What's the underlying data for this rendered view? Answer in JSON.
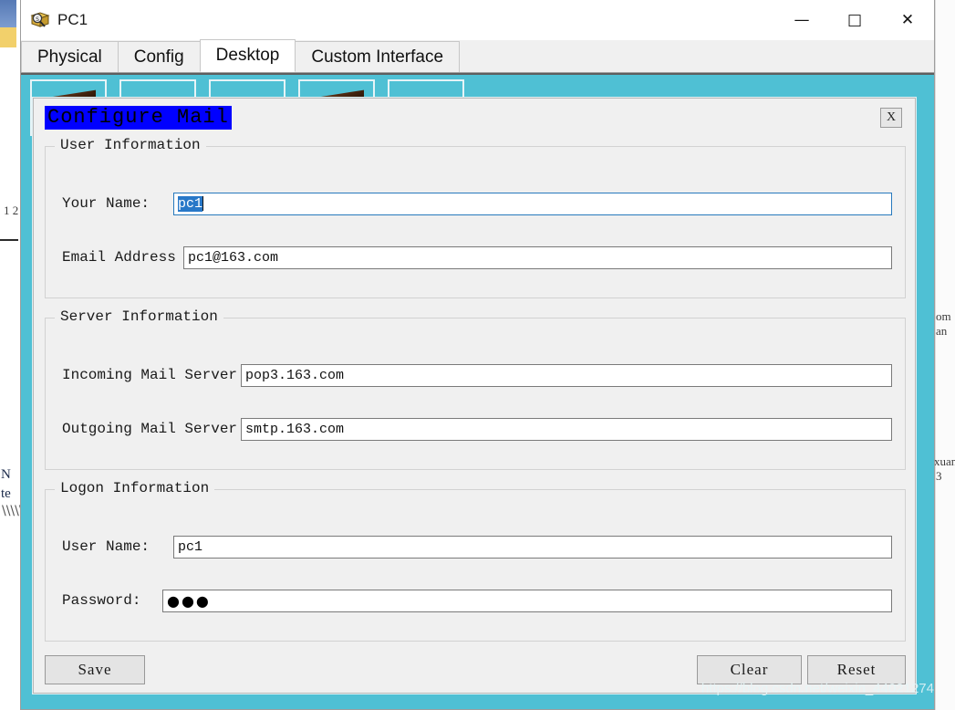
{
  "window": {
    "title": "PC1",
    "icon": "magnifier-package-icon",
    "controls": {
      "minimize_label": "—",
      "maximize_label": "□",
      "close_label": "✕"
    }
  },
  "tabs": [
    {
      "label": "Physical",
      "active": false
    },
    {
      "label": "Config",
      "active": false
    },
    {
      "label": "Desktop",
      "active": true
    },
    {
      "label": "Custom Interface",
      "active": false
    }
  ],
  "dialog": {
    "title": "Configure Mail",
    "close_label": "X",
    "groups": [
      {
        "legend": "User Information",
        "fields": [
          {
            "label": "Your Name:",
            "value": "pc1",
            "focused": true,
            "selected": true,
            "masked": false
          },
          {
            "label": "Email Address",
            "value": "pc1@163.com",
            "focused": false,
            "selected": false,
            "masked": false
          }
        ]
      },
      {
        "legend": "Server Information",
        "fields": [
          {
            "label": "Incoming Mail Server",
            "value": "pop3.163.com",
            "focused": false,
            "selected": false,
            "masked": false
          },
          {
            "label": "Outgoing Mail Server",
            "value": "smtp.163.com",
            "focused": false,
            "selected": false,
            "masked": false
          }
        ]
      },
      {
        "legend": "Logon Information",
        "fields": [
          {
            "label": "User Name:",
            "value": "pc1",
            "focused": false,
            "selected": false,
            "masked": false
          },
          {
            "label": "Password:",
            "value": "●●●",
            "focused": false,
            "selected": false,
            "masked": true
          }
        ]
      }
    ],
    "buttons": {
      "save": "Save",
      "clear": "Clear",
      "reset": "Reset"
    }
  },
  "background": {
    "watermark": "https://blog.csdn.net/weixin_44021274",
    "fragments": {
      "left_top": "1\n2",
      "left_mid_a": "N",
      "left_mid_b": "te",
      "right_a": "om",
      "right_b": "an",
      "right_c": "xuan",
      "right_d": "3"
    }
  },
  "colors": {
    "desktop_teal": "#4fc0d4",
    "dialog_title_blue": "#0000ff",
    "selection_blue": "#2878c8",
    "dialog_face": "#f0f0f0"
  }
}
